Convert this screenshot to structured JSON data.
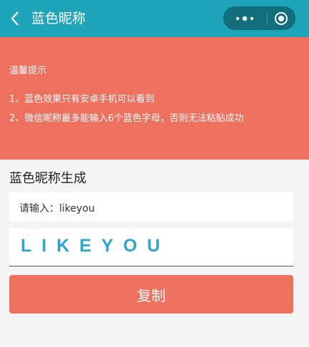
{
  "nav": {
    "title": "蓝色昵称",
    "back_icon": "chevron-left-icon",
    "more_icon": "more-dots-icon",
    "close_icon": "target-close-icon"
  },
  "notice": {
    "title": "温馨提示",
    "lines": [
      "1、蓝色效果只有安卓手机可以看到",
      "2、微信昵称最多能输入6个蓝色字母，否则无法粘贴成功"
    ]
  },
  "generator": {
    "section_title": "蓝色昵称生成",
    "input_label": "请输入：",
    "input_value": "likeyou",
    "output_text": "LIKEYOU",
    "copy_label": "复制"
  },
  "colors": {
    "nav_bg": "#1ea5ba",
    "accent": "#ee705e",
    "output_text": "#2aa6cf",
    "background": "#f4f4f4"
  }
}
